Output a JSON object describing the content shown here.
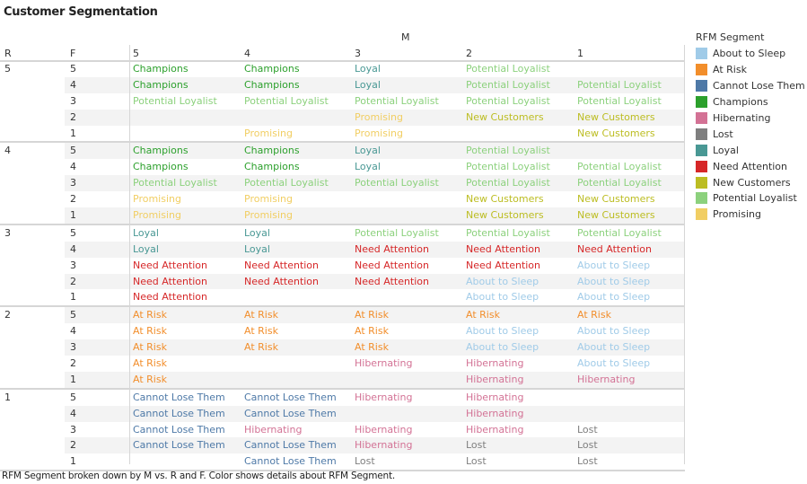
{
  "title": "Customer Segmentation",
  "caption": "RFM Segment broken down by M vs. R and F.  Color shows details about RFM Segment.",
  "chart_data": {
    "type": "table",
    "title": "Customer Segmentation",
    "row_headers": [
      "R",
      "F"
    ],
    "column_header": "M",
    "m_columns": [
      "5",
      "4",
      "3",
      "2",
      "1"
    ],
    "legend_title": "RFM Segment",
    "legend_placement": "right",
    "segments": [
      {
        "name": "About to Sleep",
        "color": "#a0cbe8"
      },
      {
        "name": "At Risk",
        "color": "#f28e2b"
      },
      {
        "name": "Cannot Lose Them",
        "color": "#4e79a7"
      },
      {
        "name": "Champions",
        "color": "#2ca02c"
      },
      {
        "name": "Hibernating",
        "color": "#d37295"
      },
      {
        "name": "Lost",
        "color": "#7f7f7f"
      },
      {
        "name": "Loyal",
        "color": "#499894"
      },
      {
        "name": "Need Attention",
        "color": "#d62728"
      },
      {
        "name": "New Customers",
        "color": "#bcbd22"
      },
      {
        "name": "Potential Loyalist",
        "color": "#8cd17d"
      },
      {
        "name": "Promising",
        "color": "#f1ce63"
      }
    ],
    "rows": [
      {
        "R": "5",
        "F": "5",
        "M": [
          "Champions",
          "Champions",
          "Loyal",
          "Potential Loyalist",
          ""
        ]
      },
      {
        "R": "5",
        "F": "4",
        "M": [
          "Champions",
          "Champions",
          "Loyal",
          "Potential Loyalist",
          "Potential Loyalist"
        ]
      },
      {
        "R": "5",
        "F": "3",
        "M": [
          "Potential Loyalist",
          "Potential Loyalist",
          "Potential Loyalist",
          "Potential Loyalist",
          "Potential Loyalist"
        ]
      },
      {
        "R": "5",
        "F": "2",
        "M": [
          "",
          "",
          "Promising",
          "New Customers",
          "New Customers"
        ]
      },
      {
        "R": "5",
        "F": "1",
        "M": [
          "",
          "Promising",
          "Promising",
          "",
          "New Customers"
        ]
      },
      {
        "R": "4",
        "F": "5",
        "M": [
          "Champions",
          "Champions",
          "Loyal",
          "Potential Loyalist",
          ""
        ]
      },
      {
        "R": "4",
        "F": "4",
        "M": [
          "Champions",
          "Champions",
          "Loyal",
          "Potential Loyalist",
          "Potential Loyalist"
        ]
      },
      {
        "R": "4",
        "F": "3",
        "M": [
          "Potential Loyalist",
          "Potential Loyalist",
          "Potential Loyalist",
          "Potential Loyalist",
          "Potential Loyalist"
        ]
      },
      {
        "R": "4",
        "F": "2",
        "M": [
          "Promising",
          "Promising",
          "",
          "New Customers",
          "New Customers"
        ]
      },
      {
        "R": "4",
        "F": "1",
        "M": [
          "Promising",
          "Promising",
          "",
          "New Customers",
          "New Customers"
        ]
      },
      {
        "R": "3",
        "F": "5",
        "M": [
          "Loyal",
          "Loyal",
          "Potential Loyalist",
          "Potential Loyalist",
          "Potential Loyalist"
        ]
      },
      {
        "R": "3",
        "F": "4",
        "M": [
          "Loyal",
          "Loyal",
          "Need Attention",
          "Need Attention",
          "Need Attention"
        ]
      },
      {
        "R": "3",
        "F": "3",
        "M": [
          "Need Attention",
          "Need Attention",
          "Need Attention",
          "Need Attention",
          "About to Sleep"
        ]
      },
      {
        "R": "3",
        "F": "2",
        "M": [
          "Need Attention",
          "Need Attention",
          "Need Attention",
          "About to Sleep",
          "About to Sleep"
        ]
      },
      {
        "R": "3",
        "F": "1",
        "M": [
          "Need Attention",
          "",
          "",
          "About to Sleep",
          "About to Sleep"
        ]
      },
      {
        "R": "2",
        "F": "5",
        "M": [
          "At Risk",
          "At Risk",
          "At Risk",
          "At Risk",
          "At Risk"
        ]
      },
      {
        "R": "2",
        "F": "4",
        "M": [
          "At Risk",
          "At Risk",
          "At Risk",
          "About to Sleep",
          "About to Sleep"
        ]
      },
      {
        "R": "2",
        "F": "3",
        "M": [
          "At Risk",
          "At Risk",
          "At Risk",
          "About to Sleep",
          "About to Sleep"
        ]
      },
      {
        "R": "2",
        "F": "2",
        "M": [
          "At Risk",
          "",
          "Hibernating",
          "Hibernating",
          "About to Sleep"
        ]
      },
      {
        "R": "2",
        "F": "1",
        "M": [
          "At Risk",
          "",
          "",
          "Hibernating",
          "Hibernating"
        ]
      },
      {
        "R": "1",
        "F": "5",
        "M": [
          "Cannot Lose Them",
          "Cannot Lose Them",
          "Hibernating",
          "Hibernating",
          ""
        ]
      },
      {
        "R": "1",
        "F": "4",
        "M": [
          "Cannot Lose Them",
          "Cannot Lose Them",
          "",
          "Hibernating",
          ""
        ]
      },
      {
        "R": "1",
        "F": "3",
        "M": [
          "Cannot Lose Them",
          "Hibernating",
          "Hibernating",
          "Hibernating",
          "Lost"
        ]
      },
      {
        "R": "1",
        "F": "2",
        "M": [
          "Cannot Lose Them",
          "Cannot Lose Them",
          "Hibernating",
          "Lost",
          "Lost"
        ]
      },
      {
        "R": "1",
        "F": "1",
        "M": [
          "",
          "Cannot Lose Them",
          "Lost",
          "Lost",
          "Lost"
        ]
      }
    ]
  }
}
